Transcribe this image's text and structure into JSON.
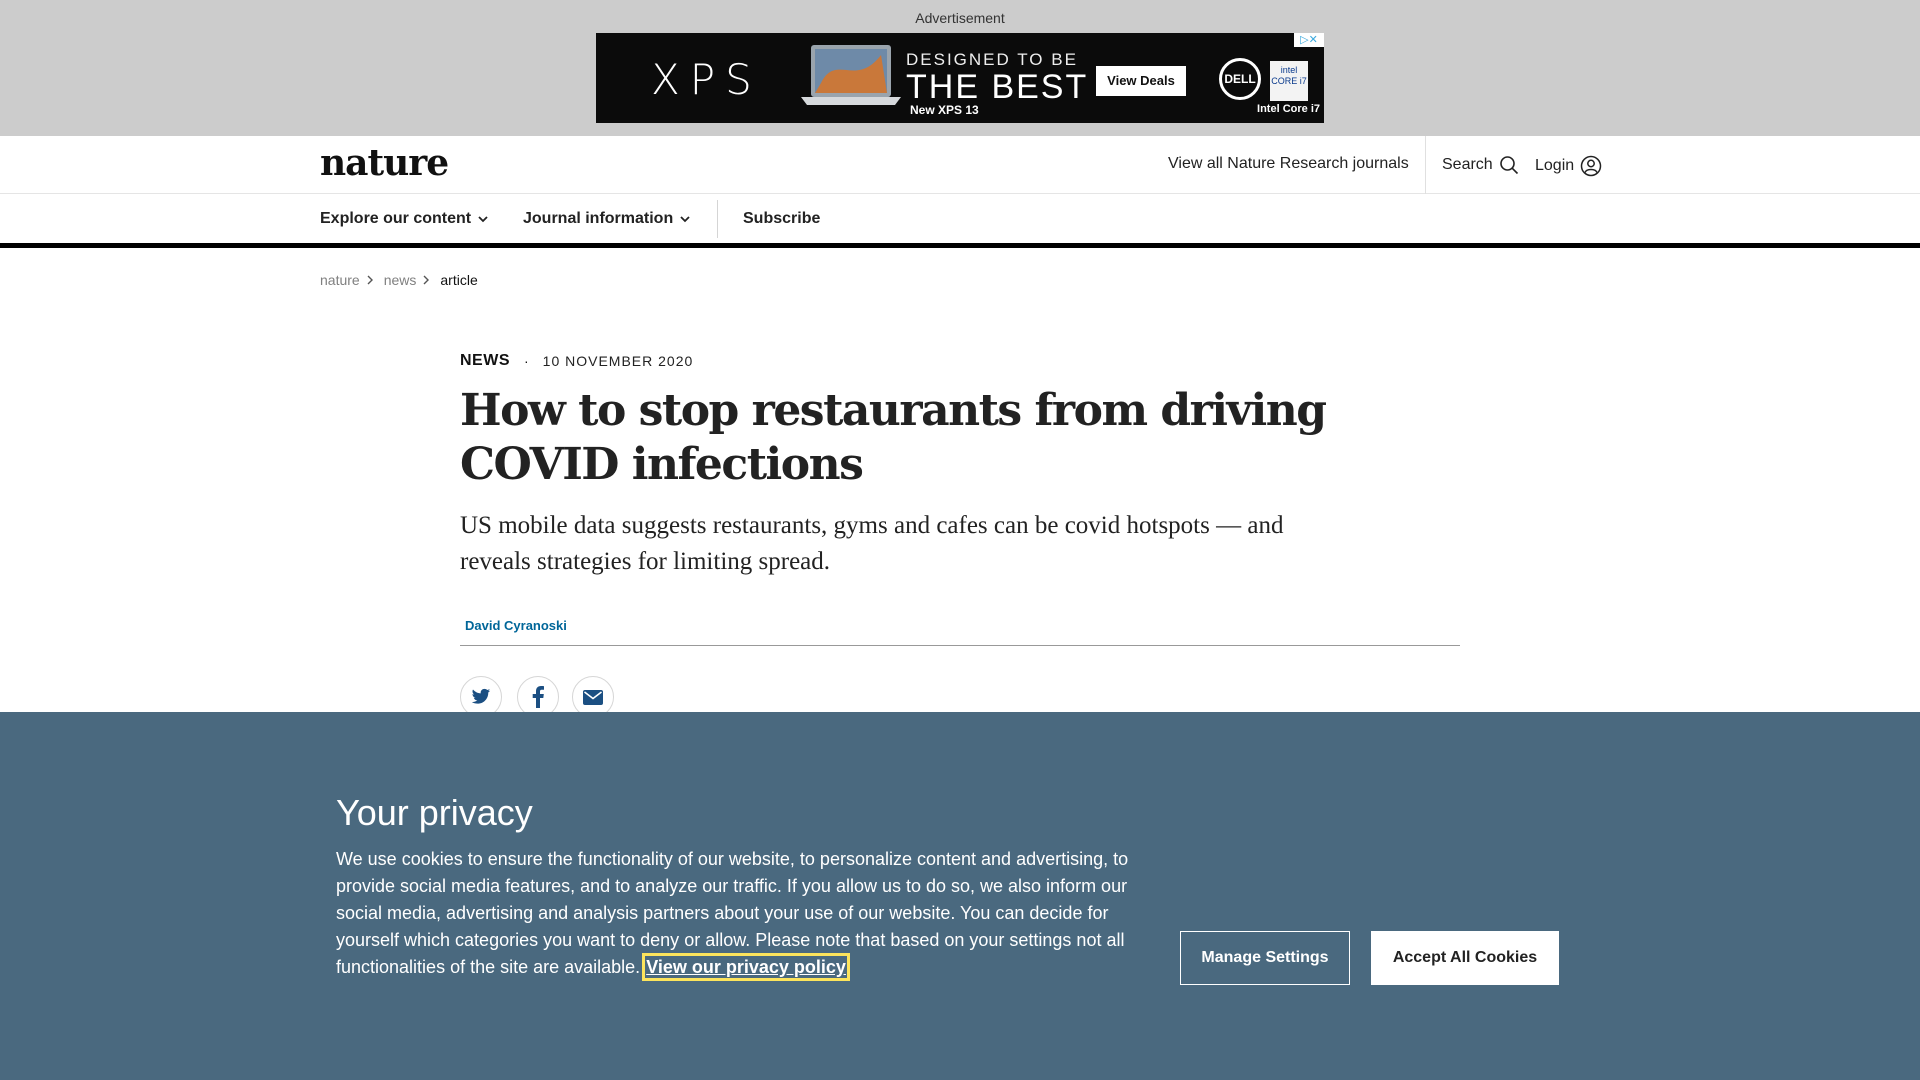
{
  "ad": {
    "label": "Advertisement",
    "brand": "XPS",
    "tagline_top": "DESIGNED TO BE",
    "tagline_main": "THE BEST",
    "model": "New XPS 13",
    "cta": "View Deals",
    "maker": "DELL",
    "chip_badge": "CORE i7",
    "chip": "Intel Core i7",
    "choices": "▷✕"
  },
  "header": {
    "logo": "nature",
    "journals_link": "View all Nature Research journals",
    "search": "Search",
    "login": "Login"
  },
  "nav": {
    "items": [
      {
        "label": "Explore our content"
      },
      {
        "label": "Journal information"
      },
      {
        "label": "Subscribe"
      }
    ]
  },
  "breadcrumb": {
    "items": [
      "nature",
      "news",
      "article"
    ]
  },
  "article": {
    "type": "NEWS",
    "date": "10 NOVEMBER 2020",
    "title": "How to stop restaurants from driving COVID infections",
    "standfirst": "US mobile data suggests restaurants, gyms and cafes can be covid hotspots — and reveals strategies for limiting spread.",
    "author": "David Cyranoski"
  },
  "share": {
    "icons": [
      "twitter-icon",
      "facebook-icon",
      "email-icon"
    ]
  },
  "cookie": {
    "title": "Your privacy",
    "text": "We use cookies to ensure the functionality of our website, to personalize content and advertising, to provide social media features, and to analyze our traffic. If you allow us to do so, we also inform our social media, advertising and analysis partners about your use of our website. You can decide for yourself which categories you want to deny or allow. Please note that based on your settings not all functionalities of the site are available.",
    "policy_link": "View our privacy policy",
    "manage_button": "Manage Settings",
    "accept_button": "Accept All Cookies"
  },
  "colors": {
    "cookie_bg": "#4a697f",
    "author_link": "#006699",
    "focus_outline": "#fce45c",
    "ad_band": "#cccccc"
  }
}
